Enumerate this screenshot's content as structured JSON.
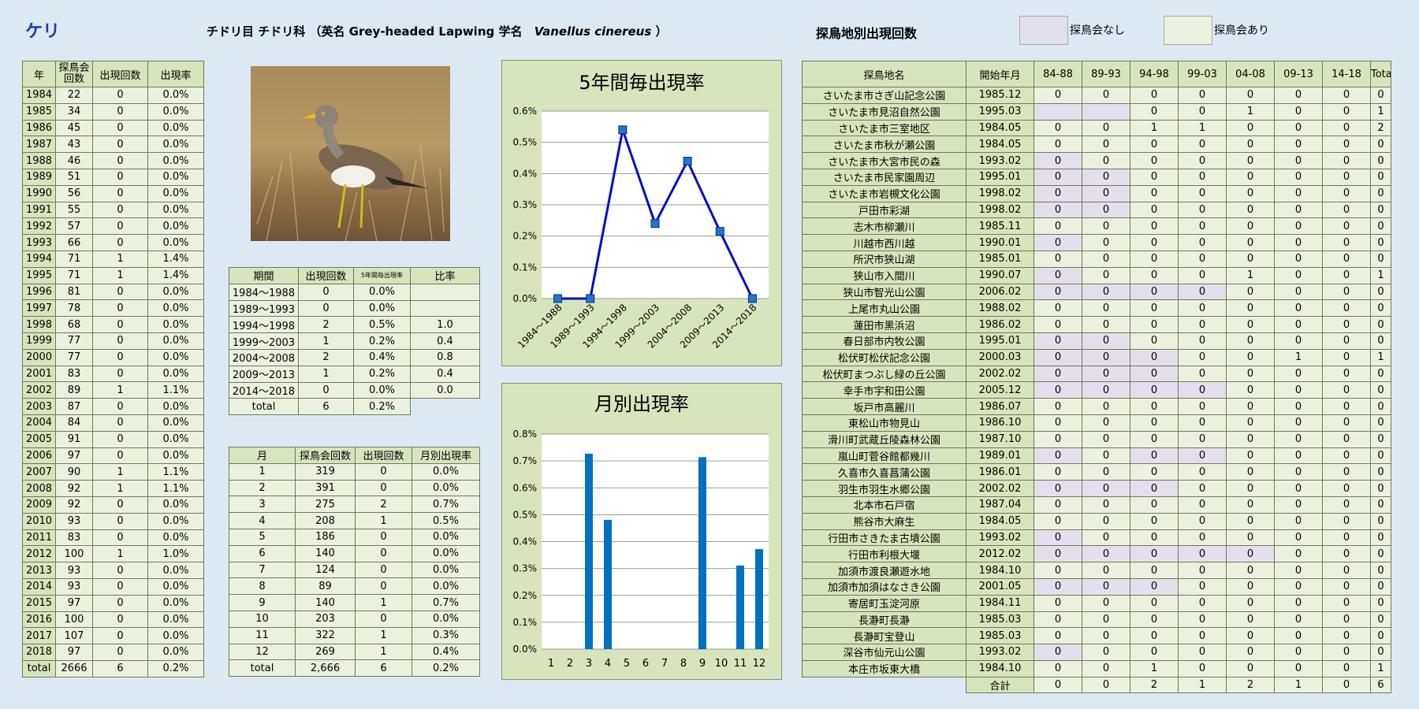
{
  "header": {
    "species": "ケリ",
    "taxonomy": "チドリ目 チドリ科 （英名 Grey-headed Lapwing 学名",
    "scientific": "Vanellus cinereus",
    "close_paren": "）",
    "site_title": "探鳥地別出現回数",
    "legend_none": "探鳥会なし",
    "legend_yes": "探鳥会あり"
  },
  "colors": {
    "bg": "#dde9f2",
    "header_cell": "#d8e4bc",
    "body_cell": "#ebf1de",
    "no_meeting": "#e4dfec",
    "line": "#0a0ac8",
    "bar": "#0070c0",
    "title": "#1f3ea8"
  },
  "yearly": {
    "headers": [
      "年",
      "探鳥会\n回数",
      "出現回数",
      "出現率"
    ],
    "rows": [
      [
        "1984",
        "22",
        "0",
        "0.0%"
      ],
      [
        "1985",
        "34",
        "0",
        "0.0%"
      ],
      [
        "1986",
        "45",
        "0",
        "0.0%"
      ],
      [
        "1987",
        "43",
        "0",
        "0.0%"
      ],
      [
        "1988",
        "46",
        "0",
        "0.0%"
      ],
      [
        "1989",
        "51",
        "0",
        "0.0%"
      ],
      [
        "1990",
        "56",
        "0",
        "0.0%"
      ],
      [
        "1991",
        "55",
        "0",
        "0.0%"
      ],
      [
        "1992",
        "57",
        "0",
        "0.0%"
      ],
      [
        "1993",
        "66",
        "0",
        "0.0%"
      ],
      [
        "1994",
        "71",
        "1",
        "1.4%"
      ],
      [
        "1995",
        "71",
        "1",
        "1.4%"
      ],
      [
        "1996",
        "81",
        "0",
        "0.0%"
      ],
      [
        "1997",
        "78",
        "0",
        "0.0%"
      ],
      [
        "1998",
        "68",
        "0",
        "0.0%"
      ],
      [
        "1999",
        "77",
        "0",
        "0.0%"
      ],
      [
        "2000",
        "77",
        "0",
        "0.0%"
      ],
      [
        "2001",
        "83",
        "0",
        "0.0%"
      ],
      [
        "2002",
        "89",
        "1",
        "1.1%"
      ],
      [
        "2003",
        "87",
        "0",
        "0.0%"
      ],
      [
        "2004",
        "84",
        "0",
        "0.0%"
      ],
      [
        "2005",
        "91",
        "0",
        "0.0%"
      ],
      [
        "2006",
        "97",
        "0",
        "0.0%"
      ],
      [
        "2007",
        "90",
        "1",
        "1.1%"
      ],
      [
        "2008",
        "92",
        "1",
        "1.1%"
      ],
      [
        "2009",
        "92",
        "0",
        "0.0%"
      ],
      [
        "2010",
        "93",
        "0",
        "0.0%"
      ],
      [
        "2011",
        "83",
        "0",
        "0.0%"
      ],
      [
        "2012",
        "100",
        "1",
        "1.0%"
      ],
      [
        "2013",
        "93",
        "0",
        "0.0%"
      ],
      [
        "2014",
        "93",
        "0",
        "0.0%"
      ],
      [
        "2015",
        "97",
        "0",
        "0.0%"
      ],
      [
        "2016",
        "100",
        "0",
        "0.0%"
      ],
      [
        "2017",
        "107",
        "0",
        "0.0%"
      ],
      [
        "2018",
        "97",
        "0",
        "0.0%"
      ]
    ],
    "total": [
      "total",
      "2666",
      "6",
      "0.2%"
    ]
  },
  "period": {
    "headers": [
      "期間",
      "出現回数",
      "5年間毎出現率",
      "比率"
    ],
    "rows": [
      [
        "1984～1988",
        "0",
        "0.0%",
        ""
      ],
      [
        "1989～1993",
        "0",
        "0.0%",
        ""
      ],
      [
        "1994～1998",
        "2",
        "0.5%",
        "1.0"
      ],
      [
        "1999～2003",
        "1",
        "0.2%",
        "0.4"
      ],
      [
        "2004～2008",
        "2",
        "0.4%",
        "0.8"
      ],
      [
        "2009～2013",
        "1",
        "0.2%",
        "0.4"
      ],
      [
        "2014～2018",
        "0",
        "0.0%",
        "0.0"
      ]
    ],
    "total": [
      "total",
      "6",
      "0.2%"
    ]
  },
  "monthly": {
    "headers": [
      "月",
      "探鳥会回数",
      "出現回数",
      "月別出現率"
    ],
    "rows": [
      [
        "1",
        "319",
        "0",
        "0.0%"
      ],
      [
        "2",
        "391",
        "0",
        "0.0%"
      ],
      [
        "3",
        "275",
        "2",
        "0.7%"
      ],
      [
        "4",
        "208",
        "1",
        "0.5%"
      ],
      [
        "5",
        "186",
        "0",
        "0.0%"
      ],
      [
        "6",
        "140",
        "0",
        "0.0%"
      ],
      [
        "7",
        "124",
        "0",
        "0.0%"
      ],
      [
        "8",
        "89",
        "0",
        "0.0%"
      ],
      [
        "9",
        "140",
        "1",
        "0.7%"
      ],
      [
        "10",
        "203",
        "0",
        "0.0%"
      ],
      [
        "11",
        "322",
        "1",
        "0.3%"
      ],
      [
        "12",
        "269",
        "1",
        "0.4%"
      ]
    ],
    "total": [
      "total",
      "2,666",
      "6",
      "0.2%"
    ]
  },
  "sites": {
    "headers": [
      "探鳥地名",
      "開始年月",
      "84-88",
      "89-93",
      "94-98",
      "99-03",
      "04-08",
      "09-13",
      "14-18",
      "Total"
    ],
    "rows": [
      {
        "name": "さいたま市さぎ山記念公園",
        "start": "1985.12",
        "v": [
          "0",
          "0",
          "0",
          "0",
          "0",
          "0",
          "0"
        ],
        "total": "0",
        "nm": []
      },
      {
        "name": "さいたま市見沼自然公園",
        "start": "1995.03",
        "v": [
          "",
          "",
          "0",
          "0",
          "1",
          "0",
          "0"
        ],
        "total": "1",
        "nm": [
          0,
          1
        ]
      },
      {
        "name": "さいたま市三室地区",
        "start": "1984.05",
        "v": [
          "0",
          "0",
          "1",
          "1",
          "0",
          "0",
          "0"
        ],
        "total": "2",
        "nm": []
      },
      {
        "name": "さいたま市秋が瀬公園",
        "start": "1984.05",
        "v": [
          "0",
          "0",
          "0",
          "0",
          "0",
          "0",
          "0"
        ],
        "total": "0",
        "nm": []
      },
      {
        "name": "さいたま市大宮市民の森",
        "start": "1993.02",
        "v": [
          "0",
          "0",
          "0",
          "0",
          "0",
          "0",
          "0"
        ],
        "total": "0",
        "nm": [
          0
        ]
      },
      {
        "name": "さいたま市民家園周辺",
        "start": "1995.01",
        "v": [
          "0",
          "0",
          "0",
          "0",
          "0",
          "0",
          "0"
        ],
        "total": "0",
        "nm": [
          0,
          1
        ]
      },
      {
        "name": "さいたま市岩槻文化公園",
        "start": "1998.02",
        "v": [
          "0",
          "0",
          "0",
          "0",
          "0",
          "0",
          "0"
        ],
        "total": "0",
        "nm": [
          0,
          1
        ]
      },
      {
        "name": "戸田市彩湖",
        "start": "1998.02",
        "v": [
          "0",
          "0",
          "0",
          "0",
          "0",
          "0",
          "0"
        ],
        "total": "0",
        "nm": [
          0,
          1
        ]
      },
      {
        "name": "志木市柳瀬川",
        "start": "1985.11",
        "v": [
          "0",
          "0",
          "0",
          "0",
          "0",
          "0",
          "0"
        ],
        "total": "0",
        "nm": []
      },
      {
        "name": "川越市西川越",
        "start": "1990.01",
        "v": [
          "0",
          "0",
          "0",
          "0",
          "0",
          "0",
          "0"
        ],
        "total": "0",
        "nm": [
          0
        ]
      },
      {
        "name": "所沢市狭山湖",
        "start": "1985.01",
        "v": [
          "0",
          "0",
          "0",
          "0",
          "0",
          "0",
          "0"
        ],
        "total": "0",
        "nm": []
      },
      {
        "name": "狭山市入間川",
        "start": "1990.07",
        "v": [
          "0",
          "0",
          "0",
          "0",
          "1",
          "0",
          "0"
        ],
        "total": "1",
        "nm": [
          0
        ]
      },
      {
        "name": "狭山市智光山公園",
        "start": "2006.02",
        "v": [
          "0",
          "0",
          "0",
          "0",
          "0",
          "0",
          "0"
        ],
        "total": "0",
        "nm": [
          0,
          1,
          2,
          3
        ]
      },
      {
        "name": "上尾市丸山公園",
        "start": "1988.02",
        "v": [
          "0",
          "0",
          "0",
          "0",
          "0",
          "0",
          "0"
        ],
        "total": "0",
        "nm": []
      },
      {
        "name": "蓮田市黒浜沼",
        "start": "1986.02",
        "v": [
          "0",
          "0",
          "0",
          "0",
          "0",
          "0",
          "0"
        ],
        "total": "0",
        "nm": []
      },
      {
        "name": "春日部市内牧公園",
        "start": "1995.01",
        "v": [
          "0",
          "0",
          "0",
          "0",
          "0",
          "0",
          "0"
        ],
        "total": "0",
        "nm": [
          0,
          1
        ]
      },
      {
        "name": "松伏町松伏記念公園",
        "start": "2000.03",
        "v": [
          "0",
          "0",
          "0",
          "0",
          "0",
          "1",
          "0"
        ],
        "total": "1",
        "nm": [
          0,
          1,
          2
        ]
      },
      {
        "name": "松伏町まつぶし緑の丘公園",
        "start": "2002.02",
        "v": [
          "0",
          "0",
          "0",
          "0",
          "0",
          "0",
          "0"
        ],
        "total": "0",
        "nm": [
          0,
          1,
          2
        ]
      },
      {
        "name": "幸手市宇和田公園",
        "start": "2005.12",
        "v": [
          "0",
          "0",
          "0",
          "0",
          "0",
          "0",
          "0"
        ],
        "total": "0",
        "nm": [
          0,
          1,
          2,
          3
        ]
      },
      {
        "name": "坂戸市高麗川",
        "start": "1986.07",
        "v": [
          "0",
          "0",
          "0",
          "0",
          "0",
          "0",
          "0"
        ],
        "total": "0",
        "nm": []
      },
      {
        "name": "東松山市物見山",
        "start": "1986.10",
        "v": [
          "0",
          "0",
          "0",
          "0",
          "0",
          "0",
          "0"
        ],
        "total": "0",
        "nm": []
      },
      {
        "name": "滑川町武蔵丘陵森林公園",
        "start": "1987.10",
        "v": [
          "0",
          "0",
          "0",
          "0",
          "0",
          "0",
          "0"
        ],
        "total": "0",
        "nm": []
      },
      {
        "name": "嵐山町菅谷館都幾川",
        "start": "1989.01",
        "v": [
          "0",
          "0",
          "0",
          "0",
          "0",
          "0",
          "0"
        ],
        "total": "0",
        "nm": [
          0,
          2,
          3
        ]
      },
      {
        "name": "久喜市久喜菖蒲公園",
        "start": "1986.01",
        "v": [
          "0",
          "0",
          "0",
          "0",
          "0",
          "0",
          "0"
        ],
        "total": "0",
        "nm": []
      },
      {
        "name": "羽生市羽生水郷公園",
        "start": "2002.02",
        "v": [
          "0",
          "0",
          "0",
          "0",
          "0",
          "0",
          "0"
        ],
        "total": "0",
        "nm": [
          0,
          1,
          2
        ]
      },
      {
        "name": "北本市石戸宿",
        "start": "1987.04",
        "v": [
          "0",
          "0",
          "0",
          "0",
          "0",
          "0",
          "0"
        ],
        "total": "0",
        "nm": []
      },
      {
        "name": "熊谷市大麻生",
        "start": "1984.05",
        "v": [
          "0",
          "0",
          "0",
          "0",
          "0",
          "0",
          "0"
        ],
        "total": "0",
        "nm": []
      },
      {
        "name": "行田市さきたま古墳公園",
        "start": "1993.02",
        "v": [
          "0",
          "0",
          "0",
          "0",
          "0",
          "0",
          "0"
        ],
        "total": "0",
        "nm": [
          0
        ]
      },
      {
        "name": "行田市利根大堰",
        "start": "2012.02",
        "v": [
          "0",
          "0",
          "0",
          "0",
          "0",
          "0",
          "0"
        ],
        "total": "0",
        "nm": [
          0,
          1,
          2,
          3,
          4
        ]
      },
      {
        "name": "加須市渡良瀬遊水地",
        "start": "1984.10",
        "v": [
          "0",
          "0",
          "0",
          "0",
          "0",
          "0",
          "0"
        ],
        "total": "0",
        "nm": []
      },
      {
        "name": "加須市加須はなさき公園",
        "start": "2001.05",
        "v": [
          "0",
          "0",
          "0",
          "0",
          "0",
          "0",
          "0"
        ],
        "total": "0",
        "nm": [
          0,
          1,
          2
        ]
      },
      {
        "name": "寄居町玉淀河原",
        "start": "1984.11",
        "v": [
          "0",
          "0",
          "0",
          "0",
          "0",
          "0",
          "0"
        ],
        "total": "0",
        "nm": []
      },
      {
        "name": "長瀞町長瀞",
        "start": "1985.03",
        "v": [
          "0",
          "0",
          "0",
          "0",
          "0",
          "0",
          "0"
        ],
        "total": "0",
        "nm": []
      },
      {
        "name": "長瀞町宝登山",
        "start": "1985.03",
        "v": [
          "0",
          "0",
          "0",
          "0",
          "0",
          "0",
          "0"
        ],
        "total": "0",
        "nm": []
      },
      {
        "name": "深谷市仙元山公園",
        "start": "1993.02",
        "v": [
          "0",
          "0",
          "0",
          "0",
          "0",
          "0",
          "0"
        ],
        "total": "0",
        "nm": [
          0
        ]
      },
      {
        "name": "本庄市坂東大橋",
        "start": "1984.10",
        "v": [
          "0",
          "0",
          "1",
          "0",
          "0",
          "0",
          "0"
        ],
        "total": "1",
        "nm": []
      }
    ],
    "sum_label": "合計",
    "sums": [
      "0",
      "0",
      "2",
      "1",
      "2",
      "1",
      "0",
      "6"
    ]
  },
  "chart_data": [
    {
      "type": "line",
      "title": "5年間毎出現率",
      "categories": [
        "1984～1988",
        "1989～1993",
        "1994～1998",
        "1999～2003",
        "2004～2008",
        "2009～2013",
        "2014～2018"
      ],
      "values": [
        0.0,
        0.0,
        0.54,
        0.24,
        0.44,
        0.215,
        0.0
      ],
      "ylim": [
        0,
        0.6
      ],
      "yticks": [
        "0.0%",
        "0.1%",
        "0.2%",
        "0.3%",
        "0.4%",
        "0.5%",
        "0.6%"
      ],
      "grid": true
    },
    {
      "type": "bar",
      "title": "月別出現率",
      "categories": [
        "1",
        "2",
        "3",
        "4",
        "5",
        "6",
        "7",
        "8",
        "9",
        "10",
        "11",
        "12"
      ],
      "values": [
        0,
        0,
        0.727,
        0.481,
        0,
        0,
        0,
        0,
        0.714,
        0,
        0.311,
        0.372
      ],
      "ylim": [
        0,
        0.8
      ],
      "yticks": [
        "0.0%",
        "0.1%",
        "0.2%",
        "0.3%",
        "0.4%",
        "0.5%",
        "0.6%",
        "0.7%",
        "0.8%"
      ],
      "grid": true
    }
  ]
}
